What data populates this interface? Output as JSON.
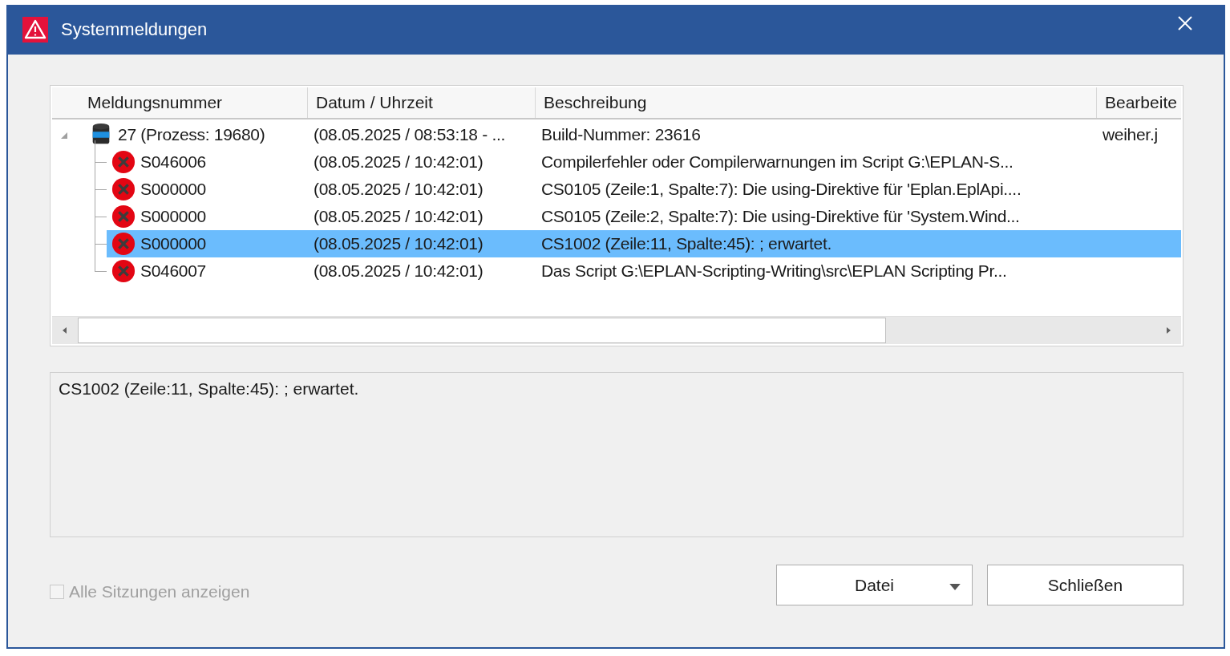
{
  "window": {
    "title": "Systemmeldungen"
  },
  "table": {
    "columns": [
      "Meldungsnummer",
      "Datum / Uhrzeit",
      "Beschreibung",
      "Bearbeite"
    ],
    "rows": [
      {
        "kind": "session",
        "expanded": true,
        "selected": false,
        "number": "27 (Prozess: 19680)",
        "datetime": "(08.05.2025 / 08:53:18 -  ...",
        "description": "Build-Nummer: 23616",
        "editor": "weiher.j",
        "children": [
          {
            "kind": "error",
            "selected": false,
            "number": "S046006",
            "datetime": "(08.05.2025 / 10:42:01)",
            "description": "Compilerfehler oder Compilerwarnungen im Script G:\\EPLAN-S..."
          },
          {
            "kind": "error",
            "selected": false,
            "number": "S000000",
            "datetime": "(08.05.2025 / 10:42:01)",
            "description": "CS0105 (Zeile:1, Spalte:7): Die using-Direktive für 'Eplan.EplApi...."
          },
          {
            "kind": "error",
            "selected": false,
            "number": "S000000",
            "datetime": "(08.05.2025 / 10:42:01)",
            "description": "CS0105 (Zeile:2, Spalte:7): Die using-Direktive für 'System.Wind..."
          },
          {
            "kind": "error",
            "selected": true,
            "number": "S000000",
            "datetime": "(08.05.2025 / 10:42:01)",
            "description": "CS1002 (Zeile:11, Spalte:45): ; erwartet."
          },
          {
            "kind": "error",
            "selected": false,
            "number": "S046007",
            "datetime": "(08.05.2025 / 10:42:01)",
            "description": "Das Script G:\\EPLAN-Scripting-Writing\\src\\EPLAN Scripting Pr..."
          }
        ]
      }
    ]
  },
  "details": {
    "text": "CS1002 (Zeile:11, Spalte:45): ; erwartet."
  },
  "show_all_sessions": {
    "label": "Alle Sitzungen anzeigen",
    "checked": false,
    "disabled": true
  },
  "buttons": [
    {
      "kind": "dropdown",
      "label": "Datei"
    },
    {
      "kind": "plain",
      "label": "Schließen"
    }
  ]
}
